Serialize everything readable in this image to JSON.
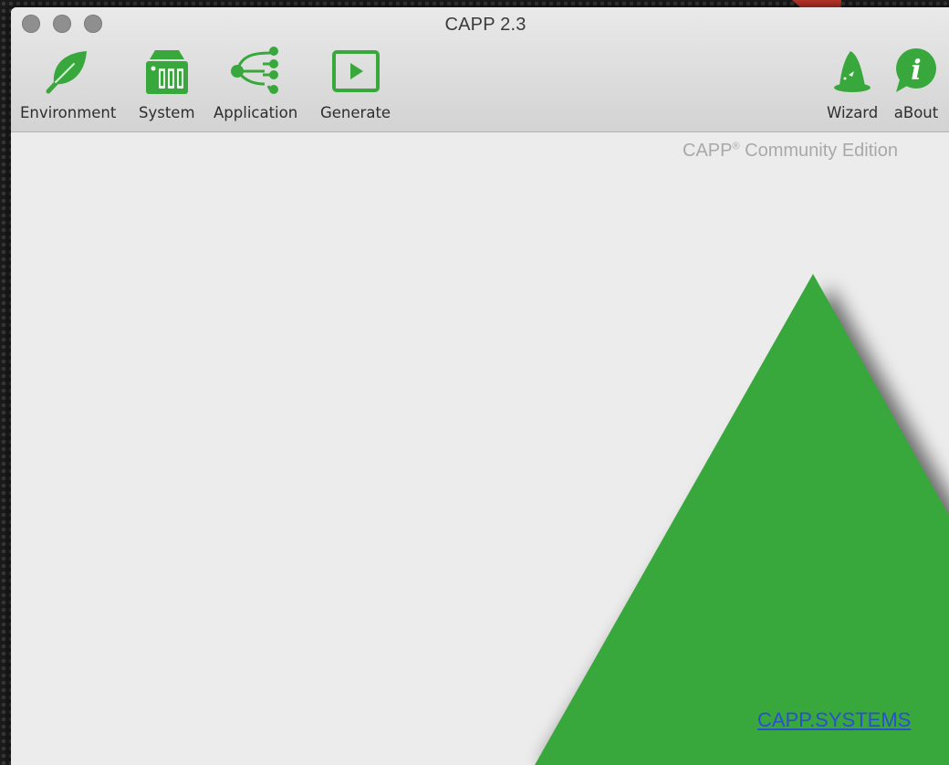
{
  "window": {
    "title": "CAPP 2.3"
  },
  "toolbar": {
    "items": [
      {
        "label": "Environment",
        "icon": "leaf-icon"
      },
      {
        "label": "System",
        "icon": "storage-drive-icon"
      },
      {
        "label": "Application",
        "icon": "tree-nodes-icon"
      },
      {
        "label": "Generate",
        "icon": "play-icon"
      },
      {
        "label": "Wizard",
        "icon": "wizard-hat-icon"
      },
      {
        "label": "aBout",
        "icon": "info-bubble-icon"
      }
    ]
  },
  "content": {
    "edition_text": "CAPP",
    "edition_mark": "®",
    "edition_suffix": " Community Edition",
    "link_text": "CAPP.SYSTEMS"
  },
  "colors": {
    "accent_green": "#39a83c",
    "annotation_arrow": "#c2372a",
    "link_blue": "#2b4fd1"
  }
}
